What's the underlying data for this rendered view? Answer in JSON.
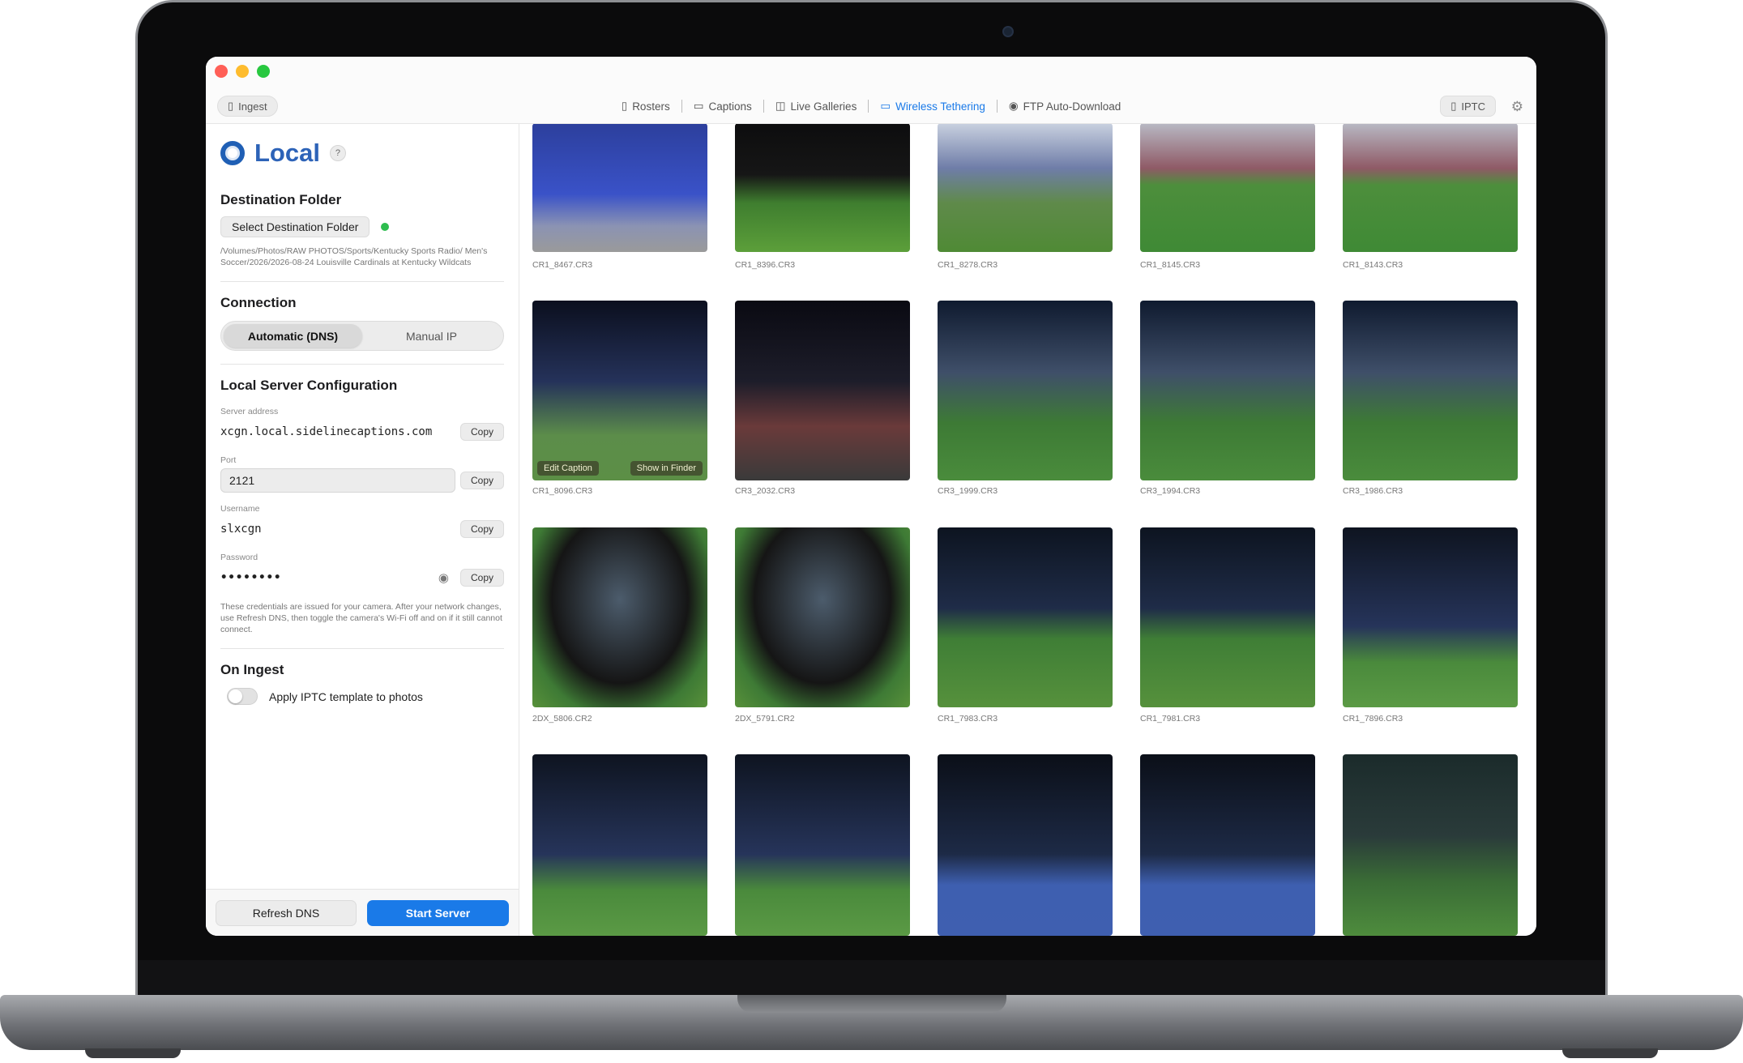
{
  "toolbar": {
    "ingest_label": "Ingest",
    "tabs": [
      {
        "label": "Rosters",
        "icon": "clipboard-icon"
      },
      {
        "label": "Captions",
        "icon": "speech-bubble-icon"
      },
      {
        "label": "Live Galleries",
        "icon": "camera-icon"
      },
      {
        "label": "Wireless Tethering",
        "icon": "monitor-icon",
        "active": true
      },
      {
        "label": "FTP Auto-Download",
        "icon": "download-circle-icon"
      }
    ],
    "iptc_label": "IPTC"
  },
  "sidebar": {
    "title": "Local",
    "help": "?",
    "destination": {
      "heading": "Destination Folder",
      "button": "Select Destination Folder",
      "path": "/Volumes/Photos/RAW PHOTOS/Sports/Kentucky Sports Radio/ Men's Soccer/2026/2026-08-24 Louisville Cardinals at Kentucky Wildcats"
    },
    "connection": {
      "heading": "Connection",
      "options": [
        "Automatic (DNS)",
        "Manual IP"
      ],
      "selected": "Automatic (DNS)"
    },
    "server": {
      "heading": "Local Server Configuration",
      "address_label": "Server address",
      "address": "xcgn.local.sidelinecaptions.com",
      "port_label": "Port",
      "port": "2121",
      "username_label": "Username",
      "username": "slxcgn",
      "password_label": "Password",
      "password": "••••••••",
      "copy": "Copy",
      "note": "These credentials are issued for your camera. After your network changes, use Refresh DNS, then toggle the camera's Wi-Fi off and on if it still cannot connect."
    },
    "on_ingest": {
      "heading": "On Ingest",
      "toggle_label": "Apply IPTC template to photos",
      "enabled": false
    },
    "footer": {
      "refresh": "Refresh DNS",
      "start": "Start Server"
    }
  },
  "gallery": {
    "overlay": {
      "edit": "Edit Caption",
      "show": "Show in Finder"
    },
    "rows": [
      [
        "CR1_8467.CR3",
        "CR1_8396.CR3",
        "CR1_8278.CR3",
        "CR1_8145.CR3",
        "CR1_8143.CR3"
      ],
      [
        "CR1_8096.CR3",
        "CR3_2032.CR3",
        "CR3_1999.CR3",
        "CR3_1994.CR3",
        "CR3_1986.CR3"
      ],
      [
        "2DX_5806.CR2",
        "2DX_5791.CR2",
        "CR1_7983.CR3",
        "CR1_7981.CR3",
        "CR1_7896.CR3"
      ],
      [
        "",
        "",
        "",
        "",
        ""
      ]
    ]
  },
  "colors": {
    "accent": "#1a7ae8",
    "brand": "#2d63b8",
    "status_ok": "#2ebd4f"
  }
}
